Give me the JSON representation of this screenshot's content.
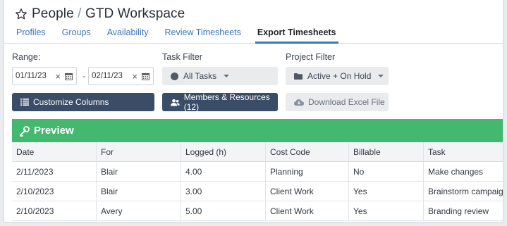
{
  "header": {
    "title_parent": "People",
    "title_separator": "/",
    "title_child": "GTD Workspace",
    "tabs": [
      {
        "label": "Profiles"
      },
      {
        "label": "Groups"
      },
      {
        "label": "Availability"
      },
      {
        "label": "Review Timesheets"
      },
      {
        "label": "Export Timesheets",
        "active": true
      }
    ]
  },
  "filters": {
    "range_label": "Range:",
    "start_date": "01/11/23",
    "end_date": "02/11/23",
    "range_separator": "-",
    "task_filter_label": "Task Filter",
    "task_filter_value": "All Tasks",
    "project_filter_label": "Project Filter",
    "project_filter_value": "Active + On Hold"
  },
  "actions": {
    "customize_columns": "Customize Columns",
    "members_resources": "Members & Resources (12)",
    "download_excel": "Download Excel File"
  },
  "preview": {
    "title": "Preview"
  },
  "table": {
    "columns": [
      "Date",
      "For",
      "Logged (h)",
      "Cost Code",
      "Billable",
      "Task"
    ],
    "rows": [
      [
        "2/11/2023",
        "Blair",
        "4.00",
        "Planning",
        "No",
        "Make changes"
      ],
      [
        "2/10/2023",
        "Blair",
        "3.00",
        "Client Work",
        "Yes",
        "Brainstorm campaig"
      ],
      [
        "2/10/2023",
        "Avery",
        "5.00",
        "Client Work",
        "Yes",
        "Branding review"
      ]
    ]
  },
  "colors": {
    "accent": "#3f73b7",
    "preview_green": "#43b86f",
    "dark_button": "#3a4c66"
  },
  "icons": [
    "star-icon",
    "calendar-icon",
    "clear-icon",
    "circle-icon",
    "caret-down-icon",
    "folder-icon",
    "columns-list-icon",
    "users-icon",
    "cloud-download-icon",
    "eye-preview-icon"
  ]
}
